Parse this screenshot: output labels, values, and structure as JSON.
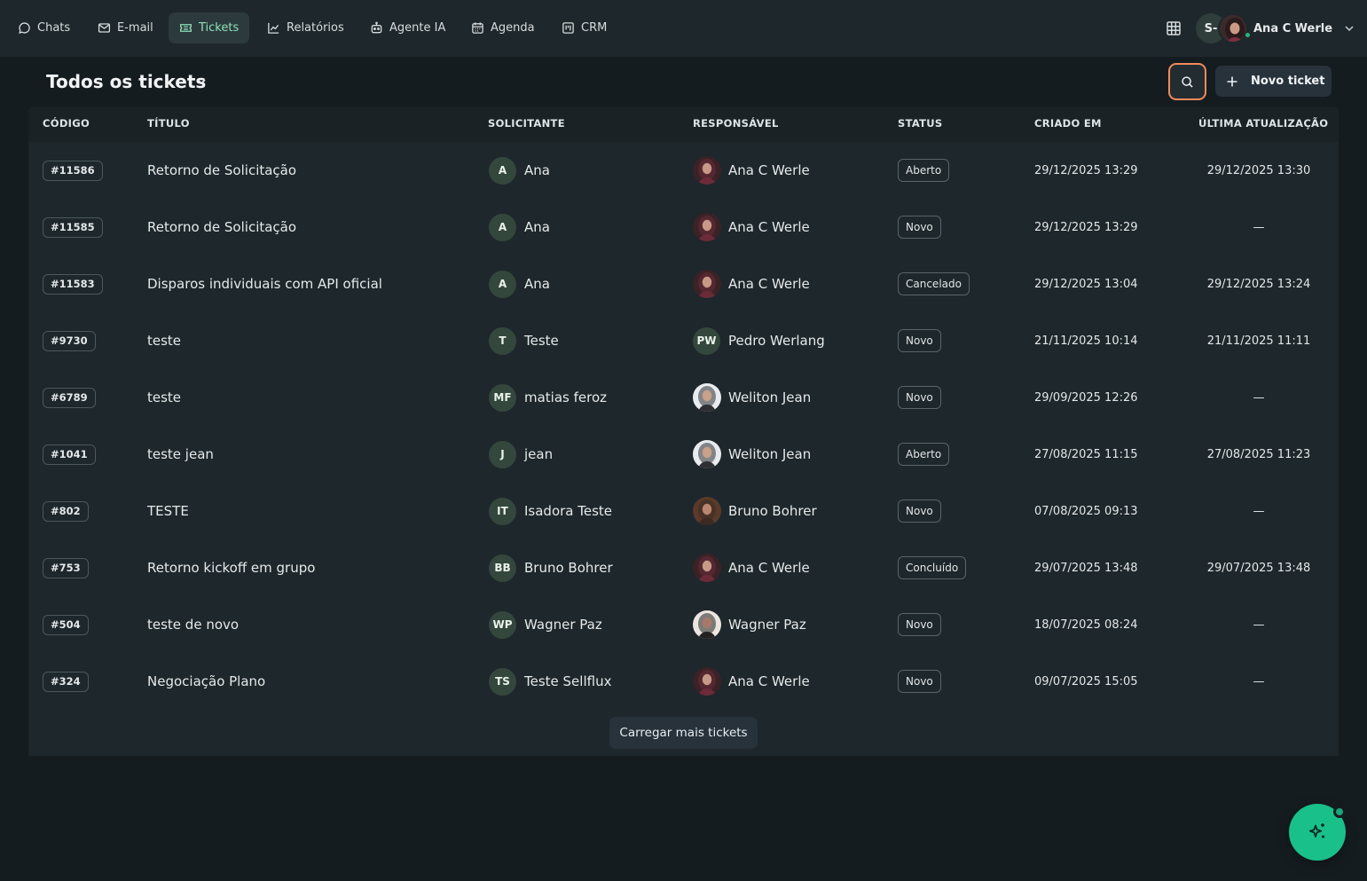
{
  "nav": {
    "items": [
      {
        "label": "Chats",
        "icon": "chat-bubble-icon",
        "active": false
      },
      {
        "label": "E-mail",
        "icon": "mail-icon",
        "active": false
      },
      {
        "label": "Tickets",
        "icon": "ticket-icon",
        "active": true
      },
      {
        "label": "Relatórios",
        "icon": "chart-line-icon",
        "active": false
      },
      {
        "label": "Agente IA",
        "icon": "bot-icon",
        "active": false
      },
      {
        "label": "Agenda",
        "icon": "calendar-icon",
        "active": false
      },
      {
        "label": "CRM",
        "icon": "kanban-icon",
        "active": false
      }
    ],
    "apps_icon": "grid-icon",
    "profile": {
      "initial": "S-",
      "name": "Ana C Werle",
      "status_color": "#2fb27e"
    }
  },
  "page": {
    "title": "Todos os tickets",
    "new_ticket_label": "Novo ticket",
    "load_more_label": "Carregar mais tickets"
  },
  "table": {
    "columns": [
      "CÓDIGO",
      "TÍTULO",
      "SOLICITANTE",
      "RESPONSÁVEL",
      "STATUS",
      "CRIADO EM",
      "ÚLTIMA ATUALIZAÇÃO"
    ],
    "rows": [
      {
        "code": "#11586",
        "title": "Retorno de Solicitação",
        "req_initials": "A",
        "requester": "Ana",
        "resp_initials": "",
        "responsible": "Ana C Werle",
        "status": "Aberto",
        "created": "29/12/2025 13:29",
        "updated": "29/12/2025 13:30"
      },
      {
        "code": "#11585",
        "title": "Retorno de Solicitação",
        "req_initials": "A",
        "requester": "Ana",
        "resp_initials": "",
        "responsible": "Ana C Werle",
        "status": "Novo",
        "created": "29/12/2025 13:29",
        "updated": "—"
      },
      {
        "code": "#11583",
        "title": "Disparos individuais com API oficial",
        "req_initials": "A",
        "requester": "Ana",
        "resp_initials": "",
        "responsible": "Ana C Werle",
        "status": "Cancelado",
        "created": "29/12/2025 13:04",
        "updated": "29/12/2025 13:24"
      },
      {
        "code": "#9730",
        "title": "teste",
        "req_initials": "T",
        "requester": "Teste",
        "resp_initials": "PW",
        "responsible": "Pedro Werlang",
        "status": "Novo",
        "created": "21/11/2025 10:14",
        "updated": "21/11/2025 11:11"
      },
      {
        "code": "#6789",
        "title": "teste",
        "req_initials": "MF",
        "requester": "matias feroz",
        "resp_initials": "",
        "responsible": "Weliton Jean",
        "status": "Novo",
        "created": "29/09/2025 12:26",
        "updated": "—"
      },
      {
        "code": "#1041",
        "title": "teste jean",
        "req_initials": "J",
        "requester": "jean",
        "resp_initials": "",
        "responsible": "Weliton Jean",
        "status": "Aberto",
        "created": "27/08/2025 11:15",
        "updated": "27/08/2025 11:23"
      },
      {
        "code": "#802",
        "title": "TESTE",
        "req_initials": "IT",
        "requester": "Isadora Teste",
        "resp_initials": "",
        "responsible": "Bruno Bohrer",
        "status": "Novo",
        "created": "07/08/2025 09:13",
        "updated": "—"
      },
      {
        "code": "#753",
        "title": "Retorno kickoff em grupo",
        "req_initials": "BB",
        "requester": "Bruno Bohrer",
        "resp_initials": "",
        "responsible": "Ana C Werle",
        "status": "Concluído",
        "created": "29/07/2025 13:48",
        "updated": "29/07/2025 13:48"
      },
      {
        "code": "#504",
        "title": "teste de novo",
        "req_initials": "WP",
        "requester": "Wagner Paz",
        "resp_initials": "",
        "responsible": "Wagner Paz",
        "status": "Novo",
        "created": "18/07/2025 08:24",
        "updated": "—"
      },
      {
        "code": "#324",
        "title": "Negociação Plano",
        "req_initials": "TS",
        "requester": "Teste Sellflux",
        "resp_initials": "",
        "responsible": "Ana C Werle",
        "status": "Novo",
        "created": "09/07/2025 15:05",
        "updated": "—"
      }
    ]
  },
  "fab": {
    "icon": "sparkles-icon",
    "color": "#19c08a"
  },
  "colors": {
    "accent": "#8ee0b5",
    "search_focus": "#f08a5a"
  }
}
